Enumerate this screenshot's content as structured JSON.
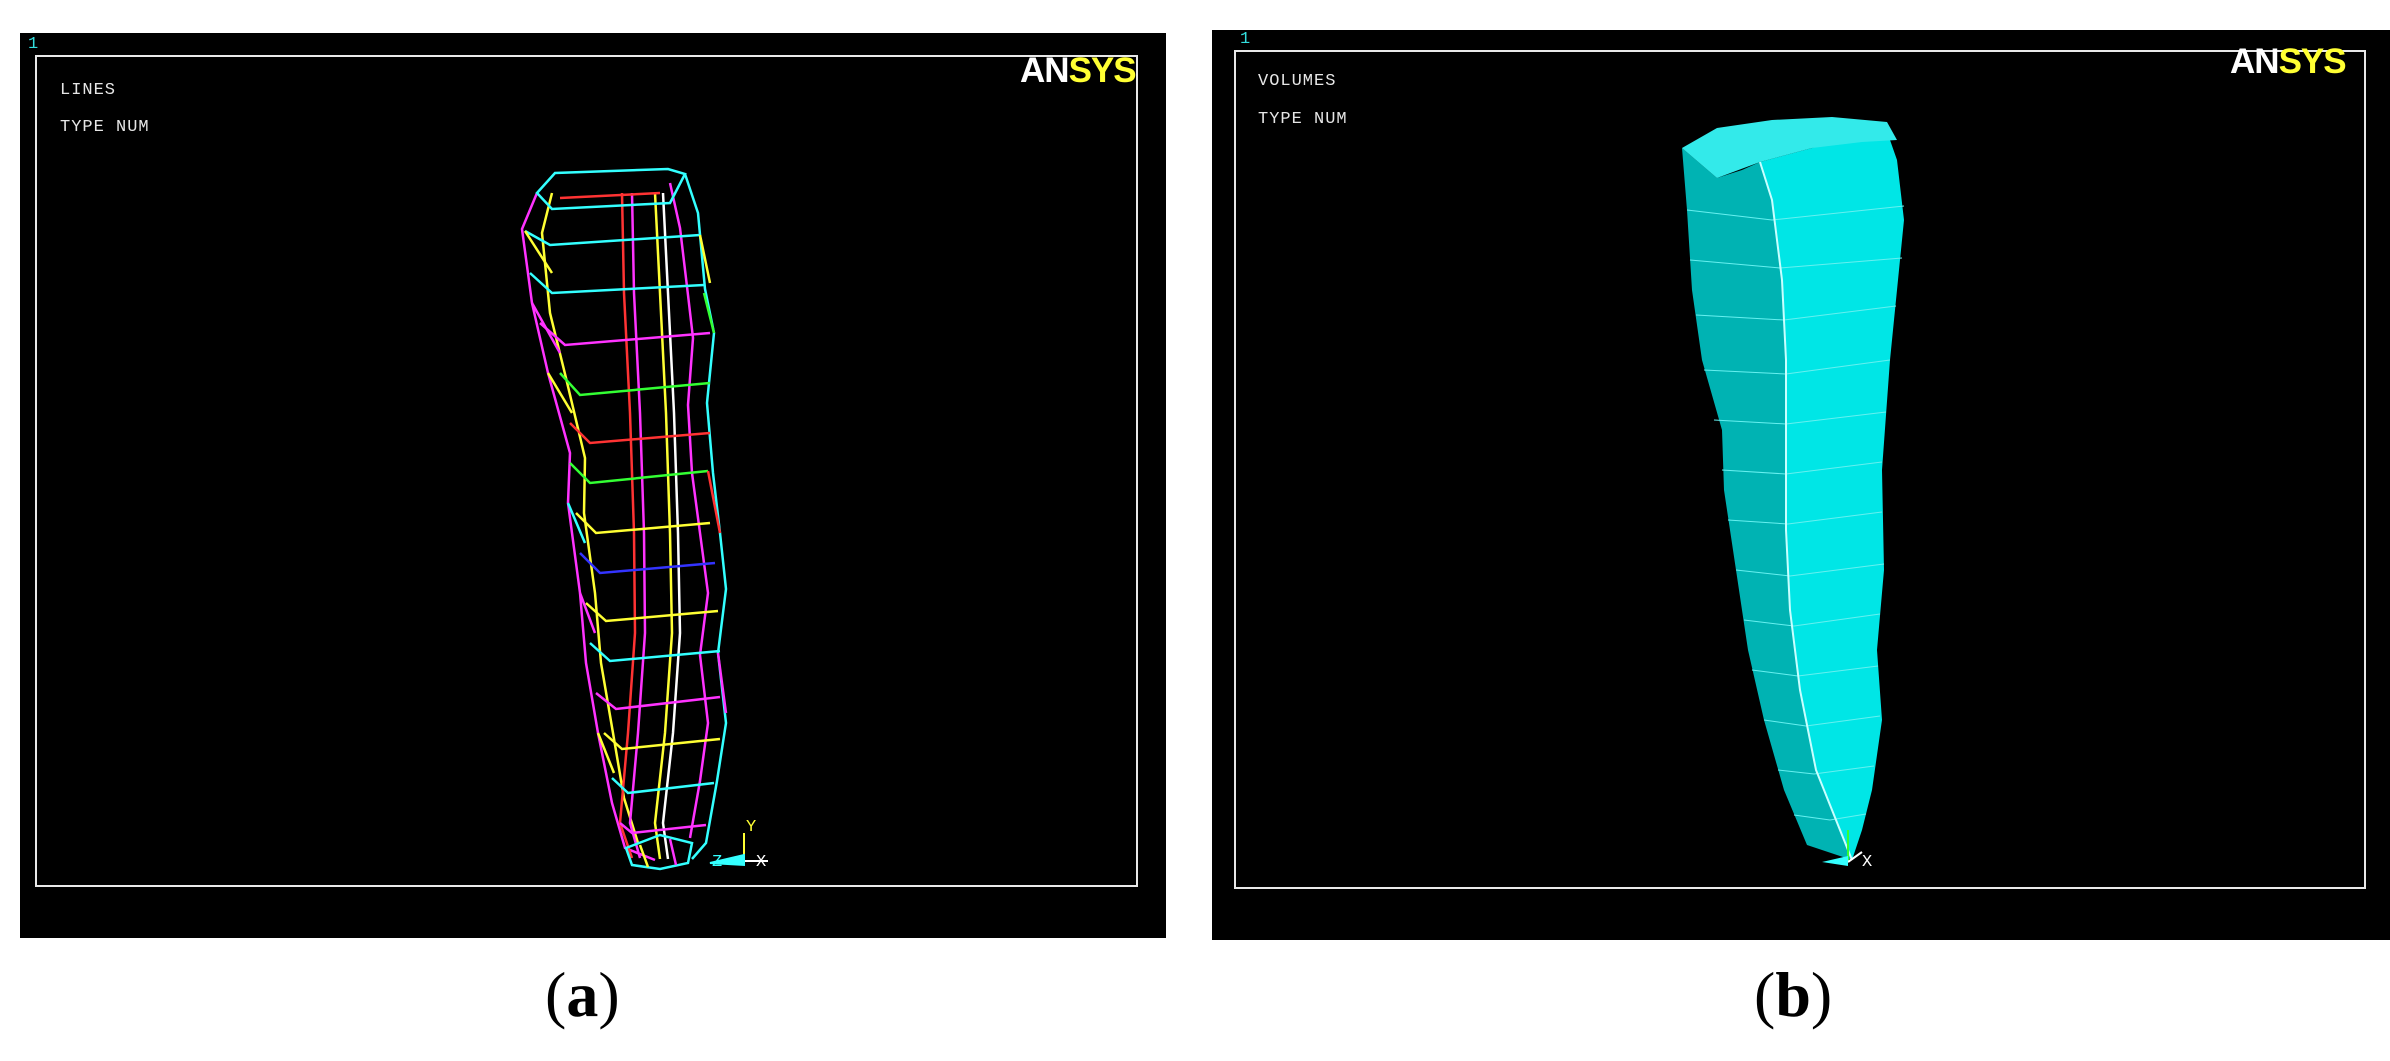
{
  "panels": [
    {
      "caption_open": "(",
      "caption_letter": "a",
      "caption_close": ")",
      "window_number": "1",
      "labels": [
        "LINES",
        "TYPE NUM"
      ],
      "logo": {
        "part1": "AN",
        "part2": "SYS"
      },
      "triad": {
        "x": "X",
        "y": "Y",
        "z": "Z"
      }
    },
    {
      "caption_open": "(",
      "caption_letter": "b",
      "caption_close": ")",
      "window_number": "1",
      "labels": [
        "VOLUMES",
        "TYPE NUM"
      ],
      "logo": {
        "part1": "AN",
        "part2": "SYS"
      },
      "triad": {
        "x": "X"
      }
    }
  ],
  "colors": {
    "background": "#000000",
    "frame": "#e8e8e8",
    "logo_an": "#ffffff",
    "logo_sys": "#ffff33",
    "volume_fill": "#00e6e6",
    "volume_shade": "#00b3b3",
    "wire": [
      "#ff33ff",
      "#33ffff",
      "#ffff33",
      "#ff3333",
      "#3333ff",
      "#33ff33"
    ]
  }
}
